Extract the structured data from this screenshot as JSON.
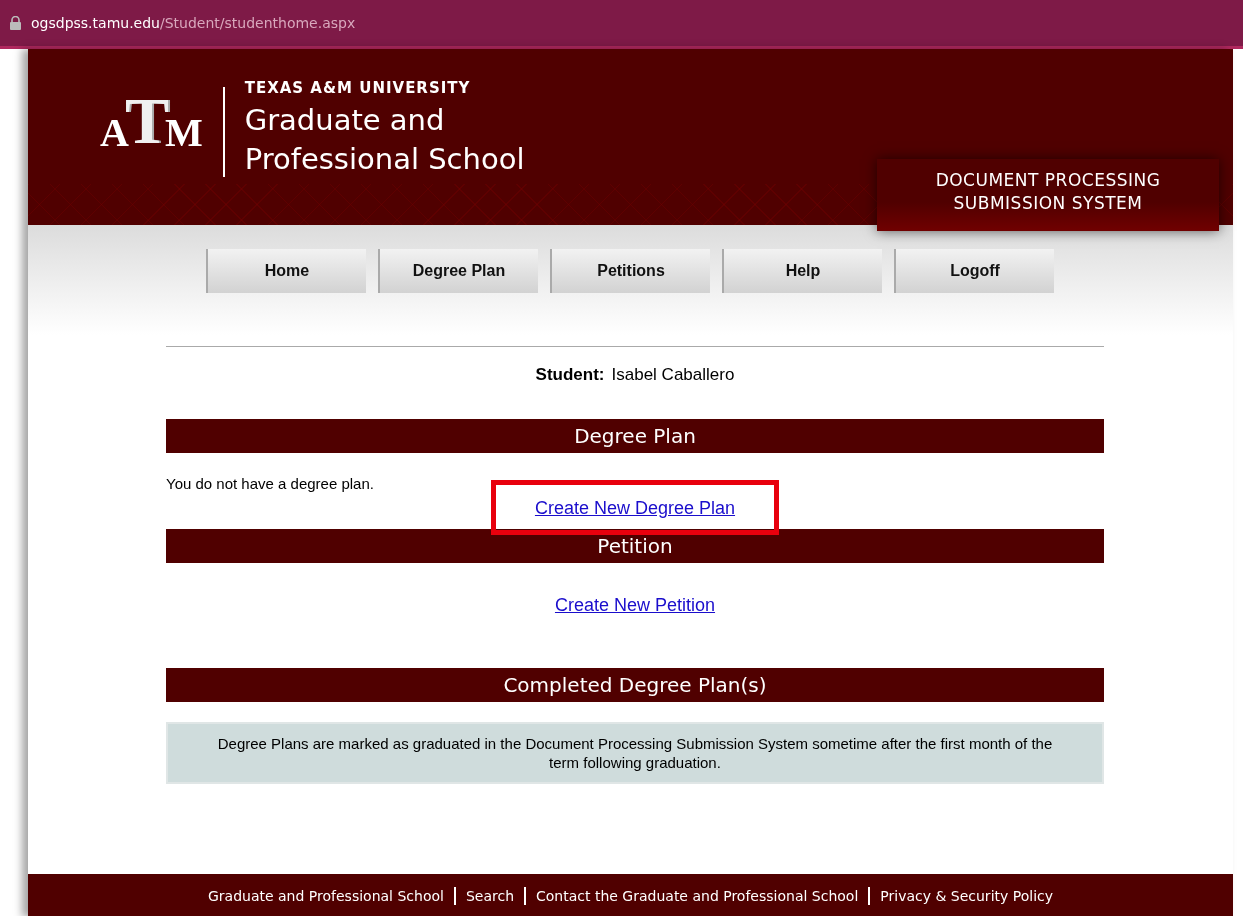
{
  "address_bar": {
    "domain": "ogsdpss.tamu.edu",
    "path": "/Student/studenthome.aspx"
  },
  "header": {
    "logo_letters": [
      "A",
      "T",
      "M"
    ],
    "university": "TEXAS A&M UNIVERSITY",
    "school_lines": [
      "Graduate and",
      "Professional School"
    ],
    "system_lines": [
      "DOCUMENT PROCESSING",
      "SUBMISSION SYSTEM"
    ]
  },
  "nav": [
    "Home",
    "Degree Plan",
    "Petitions",
    "Help",
    "Logoff"
  ],
  "student": {
    "label": "Student:",
    "name": "Isabel Caballero"
  },
  "sections": [
    {
      "title": "Degree Plan",
      "content": [
        {
          "kind": "text",
          "text": "You do not have a degree plan."
        },
        {
          "kind": "link",
          "text": "Create New Degree Plan",
          "highlighted": true
        }
      ]
    },
    {
      "title": "Petition",
      "content": [
        {
          "kind": "link",
          "text": "Create New Petition",
          "highlighted": false
        }
      ]
    },
    {
      "title": "Completed Degree Plan(s)",
      "content": [
        {
          "kind": "notice",
          "text": "Degree Plans are marked as graduated in the Document Processing Submission System sometime after the first month of the term following graduation."
        }
      ]
    }
  ],
  "footer": [
    "Graduate and Professional School",
    "Search",
    "Contact the Graduate and Professional School",
    "Privacy & Security Policy"
  ]
}
